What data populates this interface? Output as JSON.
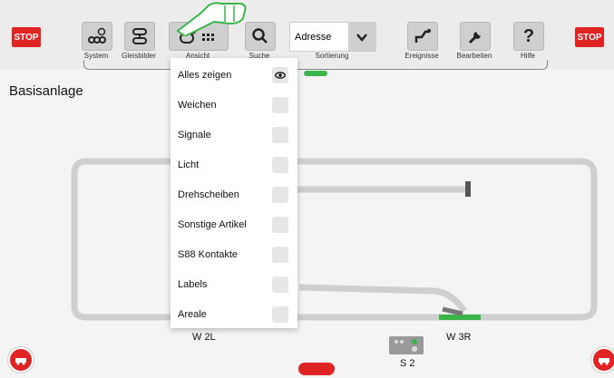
{
  "toolbar": {
    "stop_left": "STOP",
    "stop_right": "STOP",
    "system": "System",
    "gleisbilder": "Gleisbilder",
    "ansicht": "Ansicht",
    "suche": "Suche",
    "address_value": "Adresse",
    "sortierung": "Sortierung",
    "ereignisse": "Ereignisse",
    "bearbeiten": "Bearbeiten",
    "hilfe": "Hilfe"
  },
  "layout": {
    "title": "Basisanlage"
  },
  "menu": {
    "items": [
      {
        "label": "Alles zeigen",
        "icon": "eye-icon"
      },
      {
        "label": "Weichen"
      },
      {
        "label": "Signale"
      },
      {
        "label": "Licht"
      },
      {
        "label": "Drehscheiben"
      },
      {
        "label": "Sonstige Artikel"
      },
      {
        "label": "S88 Kontakte"
      },
      {
        "label": "Labels"
      },
      {
        "label": "Areale"
      }
    ]
  },
  "track": {
    "switch_left": "W 2L",
    "switch_right": "W 3R",
    "signal": "S 2"
  },
  "colors": {
    "stop": "#e02424",
    "accent": "#3ab54a",
    "track": "#cfcfcf"
  }
}
